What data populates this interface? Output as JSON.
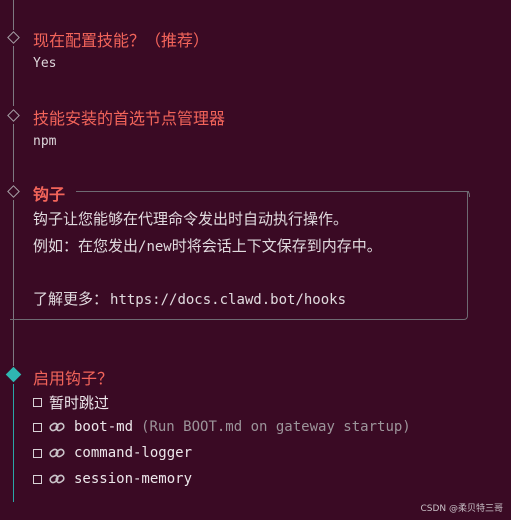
{
  "step1": {
    "title": "现在配置技能？（推荐）",
    "value": "Yes"
  },
  "step2": {
    "title": "技能安装的首选节点管理器",
    "value": "npm"
  },
  "hooks_note": {
    "title": "钩子",
    "line1": "钩子让您能够在代理命令发出时自动执行操作。",
    "line2_prefix": "例如：在您发出",
    "line2_cmd": "/new",
    "line2_suffix": "时将会话上下文保存到内存中。",
    "learn_more_label": "了解更多：",
    "learn_more_url": "https://docs.clawd.bot/hooks"
  },
  "hooks_prompt": {
    "title": "启用钩子？",
    "options": [
      {
        "label": "暂时跳过",
        "hint": "",
        "icon": ""
      },
      {
        "label": "boot-md",
        "hint": "(Run BOOT.md on gateway startup)",
        "icon": "link-icon"
      },
      {
        "label": "command-logger",
        "hint": "",
        "icon": "link-icon"
      },
      {
        "label": "session-memory",
        "hint": "",
        "icon": "link-icon"
      }
    ]
  },
  "watermark": "CSDN @柔贝特三哥",
  "colors": {
    "title": "#f2645a",
    "active": "#2fb7b1",
    "background": "#3a0a24"
  }
}
